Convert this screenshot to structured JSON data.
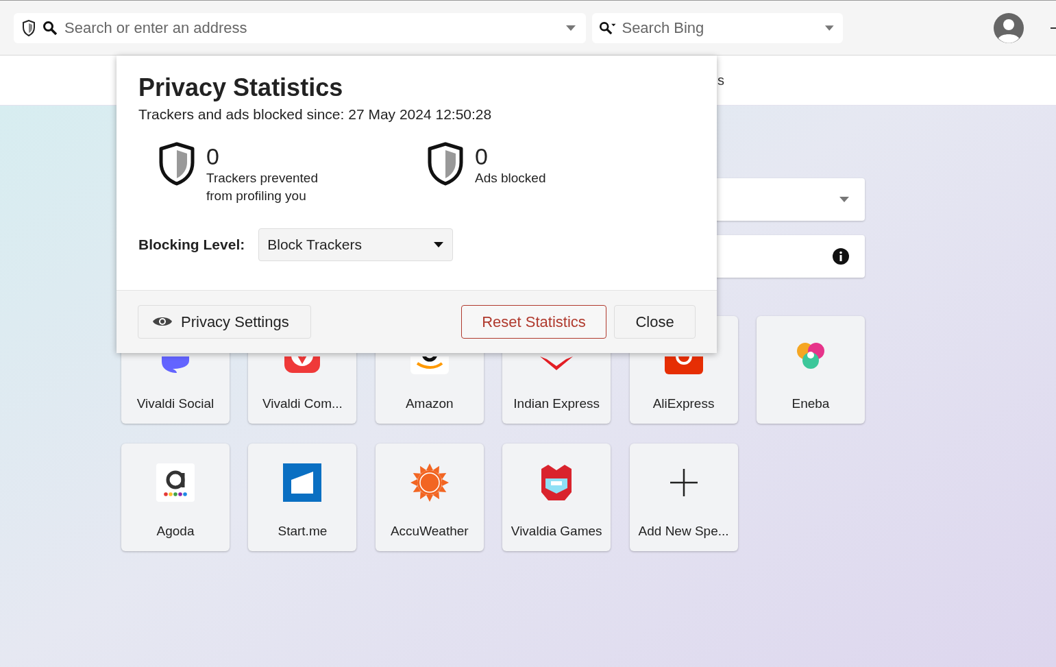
{
  "toolbar": {
    "address_field": {
      "placeholder": "Search or enter an address"
    },
    "search_field": {
      "placeholder": "Search Bing"
    }
  },
  "tab_bar": {
    "partial_label": "s"
  },
  "start_fields": [
    {
      "kind": "dropdown"
    },
    {
      "kind": "info"
    }
  ],
  "speed_dial": [
    {
      "kind": "site",
      "title": "Vivaldi Social"
    },
    {
      "kind": "site",
      "title": "Vivaldi Com..."
    },
    {
      "kind": "site",
      "title": "Amazon"
    },
    {
      "kind": "site",
      "title": "Indian Express"
    },
    {
      "kind": "site",
      "title": "AliExpress"
    },
    {
      "kind": "site",
      "title": "Eneba"
    },
    {
      "kind": "site",
      "title": "Agoda"
    },
    {
      "kind": "site",
      "title": "Start.me"
    },
    {
      "kind": "site",
      "title": "AccuWeather"
    },
    {
      "kind": "site",
      "title": "Vivaldia Games"
    },
    {
      "kind": "add",
      "title": "Add New Spe..."
    }
  ],
  "popup": {
    "title": "Privacy Statistics",
    "subtitle": "Trackers and ads blocked since: 27 May 2024 12:50:28",
    "stats": [
      {
        "value": "0",
        "label": "Trackers prevented from profiling you"
      },
      {
        "value": "0",
        "label": "Ads blocked"
      }
    ],
    "blocking_level": {
      "label": "Blocking Level:",
      "value": "Block Trackers"
    },
    "buttons": [
      {
        "kind": "settings",
        "label": "Privacy Settings"
      },
      {
        "kind": "danger",
        "label": "Reset Statistics"
      },
      {
        "kind": "plain",
        "label": "Close"
      }
    ]
  }
}
